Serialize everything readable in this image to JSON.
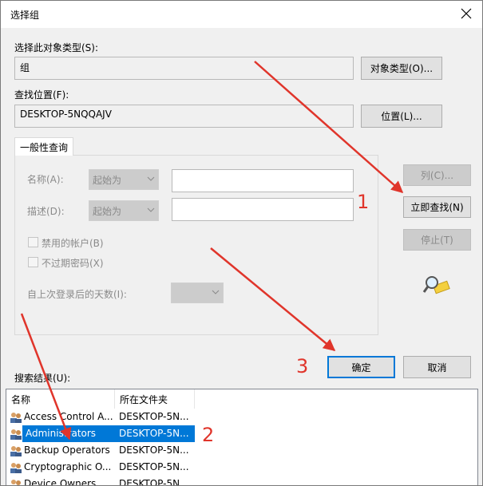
{
  "dialog": {
    "title": "选择组"
  },
  "object_type": {
    "label": "选择此对象类型(S):",
    "value": "组",
    "button": "对象类型(O)..."
  },
  "location": {
    "label": "查找位置(F):",
    "value": "DESKTOP-5NQQAJV",
    "button": "位置(L)..."
  },
  "query": {
    "tab": "一般性查询",
    "name_label": "名称(A):",
    "name_mode": "起始为",
    "desc_label": "描述(D):",
    "desc_mode": "起始为",
    "disabled_accounts": "禁用的帐户(B)",
    "non_expiring": "不过期密码(X)",
    "days_since_login": "自上次登录后的天数(I):"
  },
  "side_buttons": {
    "columns": "列(C)...",
    "find_now": "立即查找(N)",
    "stop": "停止(T)"
  },
  "actions": {
    "ok": "确定",
    "cancel": "取消"
  },
  "results": {
    "label": "搜索结果(U):",
    "columns": [
      "名称",
      "所在文件夹"
    ],
    "rows": [
      {
        "name": "Access Control A...",
        "folder": "DESKTOP-5N..."
      },
      {
        "name": "Administrators",
        "folder": "DESKTOP-5N..."
      },
      {
        "name": "Backup Operators",
        "folder": "DESKTOP-5N..."
      },
      {
        "name": "Cryptographic O...",
        "folder": "DESKTOP-5N..."
      },
      {
        "name": "Device Owners",
        "folder": "DESKTOP-5N..."
      }
    ]
  },
  "annotations": [
    "1",
    "2",
    "3"
  ],
  "colors": {
    "annotation": "#e0352b",
    "selection": "#0078d7"
  }
}
